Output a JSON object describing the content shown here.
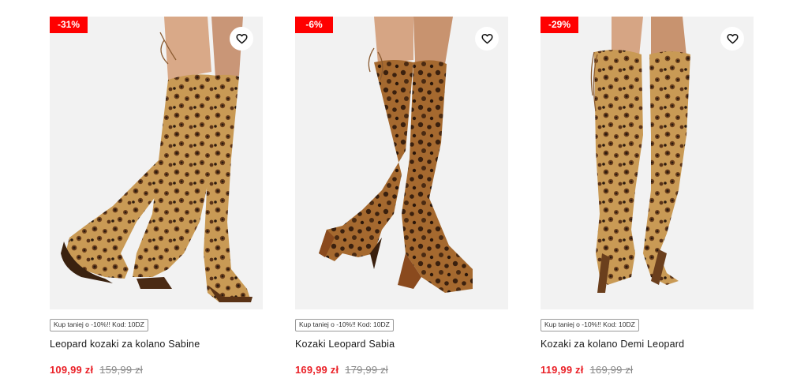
{
  "colors": {
    "badge": "#ff0000",
    "price_current": "#ea2027",
    "price_old": "#8a8a8a",
    "image_bg": "#f2f2f2"
  },
  "products": [
    {
      "discount": "-31%",
      "promo": "Kup taniej o -10%!! Kod: 10DZ",
      "name": "Leopard kozaki za kolano Sabine",
      "price_current": "109,99 zł",
      "price_old": "159,99 zł",
      "favorite_icon": "heart-outline-icon",
      "image_icon": "leopard-knee-boots-flat"
    },
    {
      "discount": "-6%",
      "promo": "Kup taniej o -10%!! Kod: 10DZ",
      "name": "Kozaki Leopard Sabia",
      "price_current": "169,99 zł",
      "price_old": "179,99 zł",
      "favorite_icon": "heart-outline-icon",
      "image_icon": "leopard-knee-boots-block-heel"
    },
    {
      "discount": "-29%",
      "promo": "Kup taniej o -10%!! Kod: 10DZ",
      "name": "Kozaki za kolano Demi Leopard",
      "price_current": "119,99 zł",
      "price_old": "169,99 zł",
      "favorite_icon": "heart-outline-icon",
      "image_icon": "leopard-knee-boots-high-heel"
    }
  ]
}
